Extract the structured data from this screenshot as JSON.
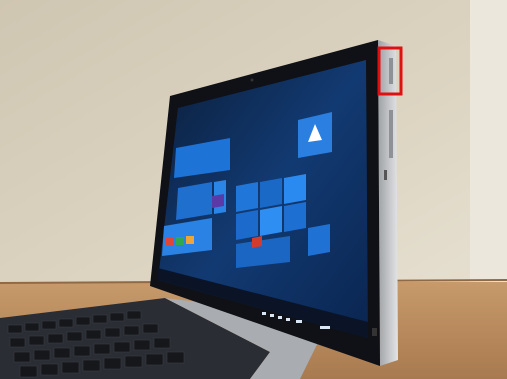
{
  "photo": {
    "subject": "tablet-laptop-side-view",
    "screen": {
      "os_start_menu_tiles": true,
      "tile_color": "#1e73d6",
      "bezel_color": "#0f1116"
    },
    "highlight_box": {
      "color": "#e01010",
      "target": "power-button"
    },
    "colors": {
      "wall": "#d8d0bd",
      "table": "#b8875c",
      "chassis": "#c7c9cc",
      "keyboard": "#23262b"
    }
  }
}
